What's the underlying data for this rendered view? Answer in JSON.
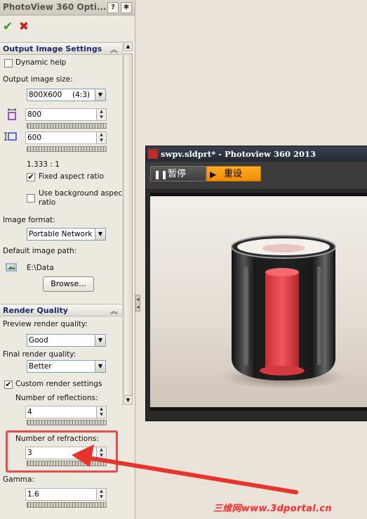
{
  "pm": {
    "title": "PhotoView 360 Opti...",
    "help_glyph": "?",
    "pin_glyph": "⁂",
    "ok_icon": "check-icon",
    "cancel_icon": "close-icon",
    "output_group": {
      "title": "Output Image Settings",
      "dynamic_help": "Dynamic help",
      "dynamic_help_checked": false,
      "image_size_label": "Output image size:",
      "image_size_value": "800X600",
      "image_size_ratio": "(4:3)",
      "width": "800",
      "height": "600",
      "aspect_text": "1.333 : 1",
      "fixed_aspect": "Fixed aspect ratio",
      "fixed_aspect_checked": true,
      "use_bg_aspect_1": "Use background aspect",
      "use_bg_aspect_2": "ratio",
      "use_bg_aspect_checked": false,
      "format_label": "Image format:",
      "format_value": "Portable Network G",
      "path_label": "Default image path:",
      "path_value": "E:\\Data",
      "browse": "Browse..."
    },
    "render_group": {
      "title": "Render Quality",
      "preview_label": "Preview render quality:",
      "preview_value": "Good",
      "final_label": "Final render quality:",
      "final_value": "Better",
      "custom_label": "Custom render settings",
      "custom_checked": true,
      "reflections_label": "Number of reflections:",
      "reflections_value": "4",
      "refractions_label": "Number of refractions:",
      "refractions_value": "3",
      "gamma_label": "Gamma:",
      "gamma_value": "1.6"
    }
  },
  "render_window": {
    "title": "swpv.sldprt* - Photoview 360 2013",
    "pause_label": "暂停",
    "reset_label": "重设"
  },
  "watermark": "三维网www.3dportal.cn",
  "colors": {
    "accent": "#f08c00",
    "annotation": "#e84c4c",
    "ok": "#2f9a2f",
    "cancel": "#d02020"
  }
}
